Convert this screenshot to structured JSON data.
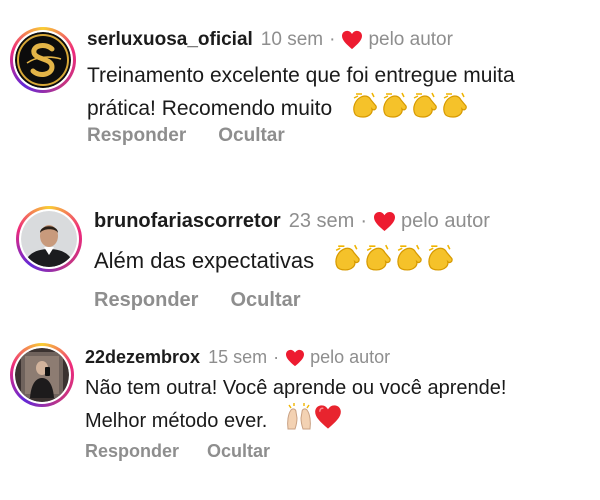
{
  "colors": {
    "accent_heart": "#ed1b30",
    "meta_gray": "#8e8e8e",
    "text": "#1a1a1a"
  },
  "comments": [
    {
      "username": "serluxuosa_oficial",
      "time": "10 sem",
      "separator": "·",
      "liked_by_author": "pelo autor",
      "text_line1": "Treinamento excelente que foi entregue muita",
      "text_line2": "prática! Recomendo muito",
      "emojis": [
        "clapping-hands",
        "clapping-hands",
        "clapping-hands",
        "clapping-hands"
      ],
      "reply_label": "Responder",
      "hide_label": "Ocultar",
      "avatar_icon": "gold-s-logo"
    },
    {
      "username": "brunofariascorretor",
      "time": "23 sem",
      "separator": "·",
      "liked_by_author": "pelo autor",
      "text_line1": "Além das expectativas",
      "emojis": [
        "clapping-hands",
        "clapping-hands",
        "clapping-hands",
        "clapping-hands"
      ],
      "reply_label": "Responder",
      "hide_label": "Ocultar",
      "avatar_icon": "man-portrait"
    },
    {
      "username": "22dezembrox",
      "time": "15 sem",
      "separator": "·",
      "liked_by_author": "pelo autor",
      "text_line1": "Não tem outra! Você aprende ou você aprende!",
      "text_line2": "Melhor método ever.",
      "emojis": [
        "raising-hands",
        "red-heart"
      ],
      "reply_label": "Responder",
      "hide_label": "Ocultar",
      "avatar_icon": "mirror-selfie-photo"
    }
  ]
}
